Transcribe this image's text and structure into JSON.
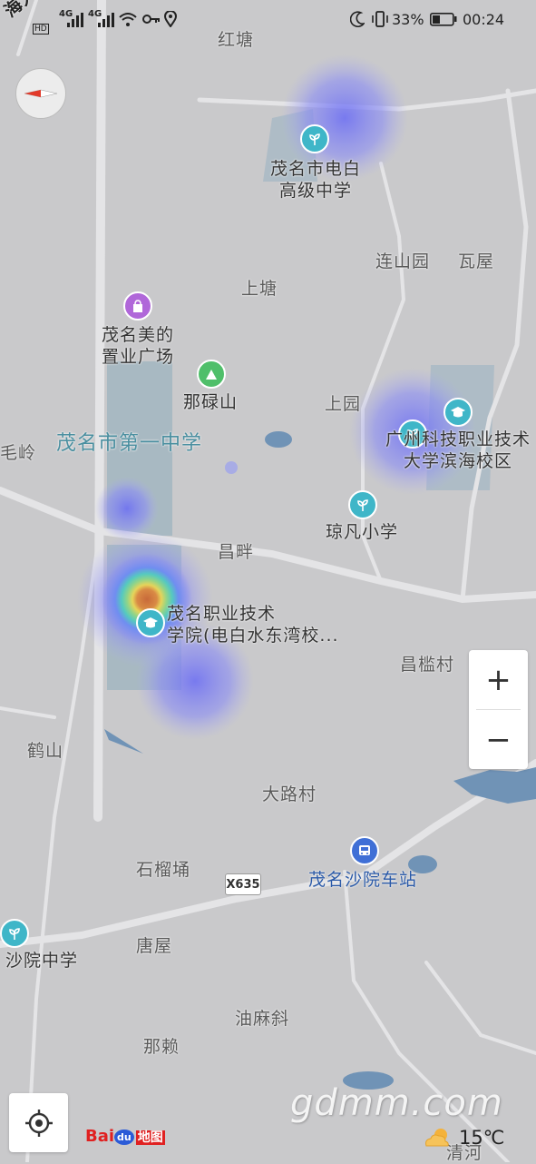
{
  "status_bar": {
    "signal_1": "4G",
    "signal_2": "4G",
    "hd": "HD",
    "battery": "33%",
    "time": "00:24"
  },
  "labels": {
    "hong_tang": "红塘",
    "dianbai_school_1": "茂名市电白",
    "dianbai_school_2": "高级中学",
    "lianshanyuan": "连山园",
    "wawu": "瓦屋",
    "shangtang": "上塘",
    "mall_1": "茂名美的",
    "mall_2": "置业广场",
    "nalushan": "那碌山",
    "no1_school": "茂名市第一中学",
    "shangyuan": "上园",
    "gz_univ_1": "广州科技职业技术",
    "gz_univ_2": "大学滨海校区",
    "qiongfan": "琼凡小学",
    "changpan": "昌畔",
    "vocational_1": "茂名职业技术",
    "vocational_2": "学院(电白水东湾校...",
    "changlancun": "昌槛村",
    "heshan": "鹤山",
    "dalucun": "大路村",
    "shiliutong": "石榴埇",
    "shayuan_station": "茂名沙院车站",
    "shayuan_school": "沙院中学",
    "tangwu": "唐屋",
    "youmaxie": "油麻斜",
    "nalai": "那赖",
    "left_top": "海大道",
    "left_mid": "毛岭",
    "road_shield": "X635",
    "bottom_right": "清河"
  },
  "controls": {
    "zoom_in": "+",
    "zoom_out": "−"
  },
  "brand": {
    "bai": "Bai",
    "du": "du",
    "ditu": "地图"
  },
  "watermark": "gdmm.com",
  "weather": {
    "temperature": "15℃",
    "icon": "partly-cloudy-icon"
  },
  "colors": {
    "map_bg": "#c9c9cb",
    "road": "#e2e2e4",
    "water": "#6f8fb0",
    "heat_blue": "#7a7cf0",
    "poi_teal": "#3fb6c8",
    "poi_purple": "#b067d9",
    "poi_green": "#4fbf6a",
    "poi_blue": "#3f6fd6"
  }
}
